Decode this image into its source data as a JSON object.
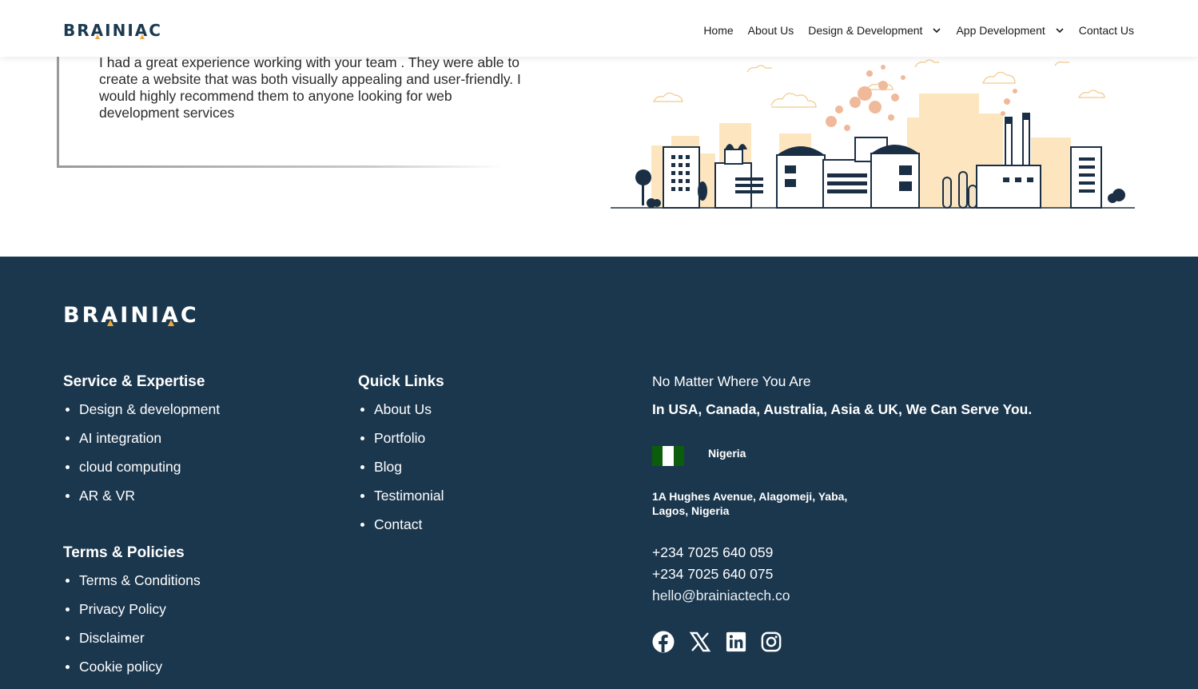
{
  "header": {
    "logo": "BRAINIAC",
    "nav": [
      {
        "label": "Home"
      },
      {
        "label": "About Us"
      },
      {
        "label": "Design & Development"
      },
      {
        "label": "App Development"
      },
      {
        "label": "Contact Us"
      }
    ]
  },
  "testimonial": {
    "text": "I had a great experience working with your team . They were able to create a website that was both visually appealing and user-friendly. I would highly recommend them to anyone looking for web development services"
  },
  "footer": {
    "logo": "BRAINIAC",
    "services": {
      "title": "Service & Expertise",
      "items": [
        "Design & development",
        "AI integration",
        "cloud computing",
        "AR & VR"
      ]
    },
    "terms": {
      "title": "Terms & Policies",
      "items": [
        "Terms & Conditions",
        "Privacy Policy",
        "Disclaimer",
        "Cookie policy"
      ]
    },
    "quick_links": {
      "title": "Quick Links",
      "items": [
        "About Us",
        "Portfolio",
        "Blog",
        "Testimonial",
        "Contact"
      ]
    },
    "contact": {
      "heading": "No Matter Where You Are",
      "subheading": "In USA, Canada, Australia, Asia & UK, We Can Serve You.",
      "country": "Nigeria",
      "address_line1": "1A Hughes Avenue, Alagomeji, Yaba,",
      "address_line2": "Lagos, Nigeria",
      "phone1": "+234 7025 640 059",
      "phone2": "+234 7025 640 075",
      "email": "hello@brainiactech.co"
    },
    "social_icons": [
      "facebook-icon",
      "x-twitter-icon",
      "linkedin-icon",
      "instagram-icon"
    ]
  },
  "colors": {
    "brand_navy": "#1b374e",
    "accent_orange": "#f2a93b",
    "flag_green": "#0b5d0b"
  }
}
